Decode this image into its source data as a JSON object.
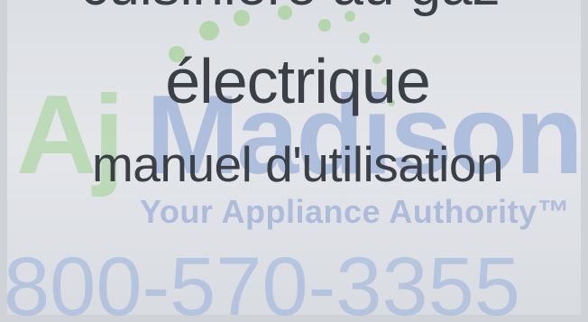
{
  "cover": {
    "title_line_1": "cuisinière au gaz",
    "title_line_2": "électrique",
    "subtitle": "manuel d'utilisation"
  },
  "watermark": {
    "brand_aj": "Aj",
    "brand_madison": "Madison",
    "tagline": "Your Appliance Authority™",
    "phone": "800-570-3355",
    "colors": {
      "green": "#8fce7d",
      "blue": "#6f8fcf"
    }
  }
}
